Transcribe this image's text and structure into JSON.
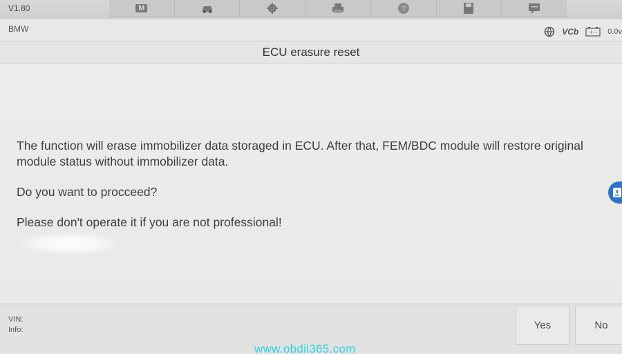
{
  "header": {
    "version": "V1.80",
    "toolbar": [
      {
        "icon": "home-m-icon",
        "label": "M"
      },
      {
        "icon": "car-icon"
      },
      {
        "icon": "gear-icon"
      },
      {
        "icon": "printer-icon"
      },
      {
        "icon": "help-icon"
      },
      {
        "icon": "save-icon"
      },
      {
        "icon": "message-icon"
      }
    ]
  },
  "status": {
    "vehicle": "BMW",
    "vci": "VCb",
    "voltage": "0.0v"
  },
  "page": {
    "title": "ECU erasure reset"
  },
  "dialog": {
    "message1": "The function will erase immobilizer data storaged in ECU. After that, FEM/BDC module will restore original module status without immobilizer data.",
    "message2": "Do you want to procceed?",
    "message3": "Please don't operate it if you are not professional!"
  },
  "footer": {
    "vin_label": "VIN:",
    "info_label": "Info:",
    "yes_label": "Yes",
    "no_label": "No"
  },
  "watermark": "www.obdii365.com",
  "colors": {
    "float_button": "#2d72c9",
    "watermark": "#2bd3e6"
  }
}
